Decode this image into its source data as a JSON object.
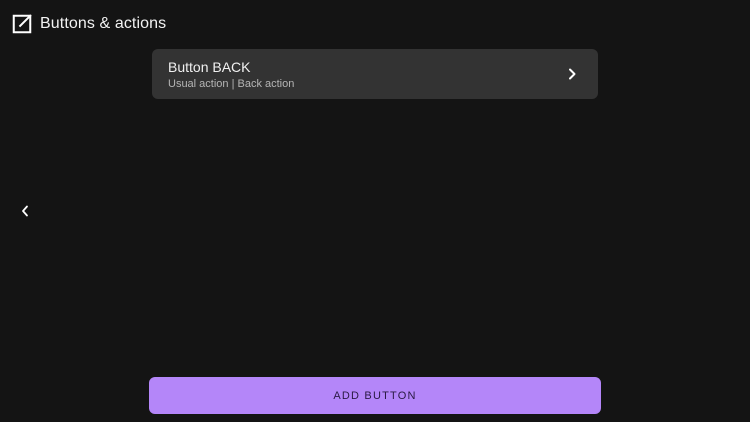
{
  "header": {
    "icon": "open-in-new-icon",
    "title": "Buttons & actions"
  },
  "list": {
    "items": [
      {
        "title": "Button BACK",
        "subtitle": "Usual action | Back action",
        "icon": "chevron-right-icon"
      }
    ]
  },
  "nav": {
    "back_icon": "chevron-left-icon"
  },
  "footer": {
    "add_button_label": "ADD BUTTON"
  },
  "colors": {
    "background": "#141414",
    "card": "#333333",
    "accent": "#b486f9",
    "accent_text": "#2a1a44",
    "text_primary": "#f0f0f0",
    "text_secondary": "#b5b5b5"
  }
}
